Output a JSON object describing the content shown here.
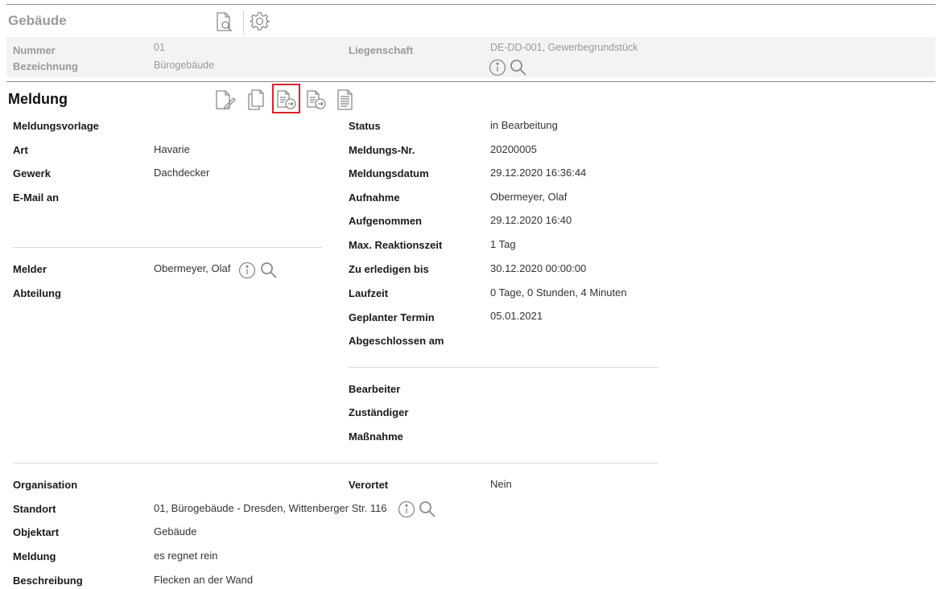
{
  "gebaeude": {
    "title": "Gebäude",
    "fields": {
      "nummer_label": "Nummer",
      "nummer_value": "01",
      "bezeichnung_label": "Bezeichnung",
      "bezeichnung_value": "Bürogebäude",
      "liegenschaft_label": "Liegenschaft",
      "liegenschaft_value": "DE-DD-001, Gewerbegrundstück"
    },
    "icons": [
      "document-search-icon",
      "gear-icon"
    ]
  },
  "meldung": {
    "title": "Meldung",
    "toolbar_icons": [
      "edit-document-icon",
      "copy-document-icon",
      "forward-document-icon",
      "forward-document-icon",
      "document-list-icon"
    ],
    "highlighted_icon_index": 2,
    "left": {
      "meldungsvorlage_label": "Meldungsvorlage",
      "art_label": "Art",
      "art_value": "Havarie",
      "gewerk_label": "Gewerk",
      "gewerk_value": "Dachdecker",
      "email_label": "E-Mail an",
      "melder_label": "Melder",
      "melder_value": "Obermeyer, Olaf",
      "abteilung_label": "Abteilung"
    },
    "right": {
      "status_label": "Status",
      "status_value": "in Bearbeitung",
      "nr_label": "Meldungs-Nr.",
      "nr_value": "20200005",
      "datum_label": "Meldungsdatum",
      "datum_value": "29.12.2020 16:36:44",
      "aufnahme_label": "Aufnahme",
      "aufnahme_value": "Obermeyer, Olaf",
      "aufgenommen_label": "Aufgenommen",
      "aufgenommen_value": "29.12.2020 16:40",
      "reaktion_label": "Max. Reaktionszeit",
      "reaktion_value": "1 Tag",
      "erledigen_label": "Zu erledigen bis",
      "erledigen_value": "30.12.2020 00:00:00",
      "laufzeit_label": "Laufzeit",
      "laufzeit_value": "0 Tage, 0 Stunden, 4 Minuten",
      "termin_label": "Geplanter Termin",
      "termin_value": "05.01.2021",
      "abgeschlossen_label": "Abgeschlossen am",
      "bearbeiter_label": "Bearbeiter",
      "zustaendiger_label": "Zuständiger",
      "massnahme_label": "Maßnahme"
    },
    "bottom": {
      "organisation_label": "Organisation",
      "verortet_label": "Verortet",
      "verortet_value": "Nein",
      "standort_label": "Standort",
      "standort_value": "01, Bürogebäude - Dresden, Wittenberger Str. 116",
      "objektart_label": "Objektart",
      "objektart_value": "Gebäude",
      "meldung_label": "Meldung",
      "meldung_value": "es regnet rein",
      "beschreibung_label": "Beschreibung",
      "beschreibung_value": "Flecken an der Wand"
    }
  },
  "colors": {
    "highlight": "#e0202a",
    "icon_grey": "#8a8a8a",
    "label_grey": "#9a9a9a"
  }
}
